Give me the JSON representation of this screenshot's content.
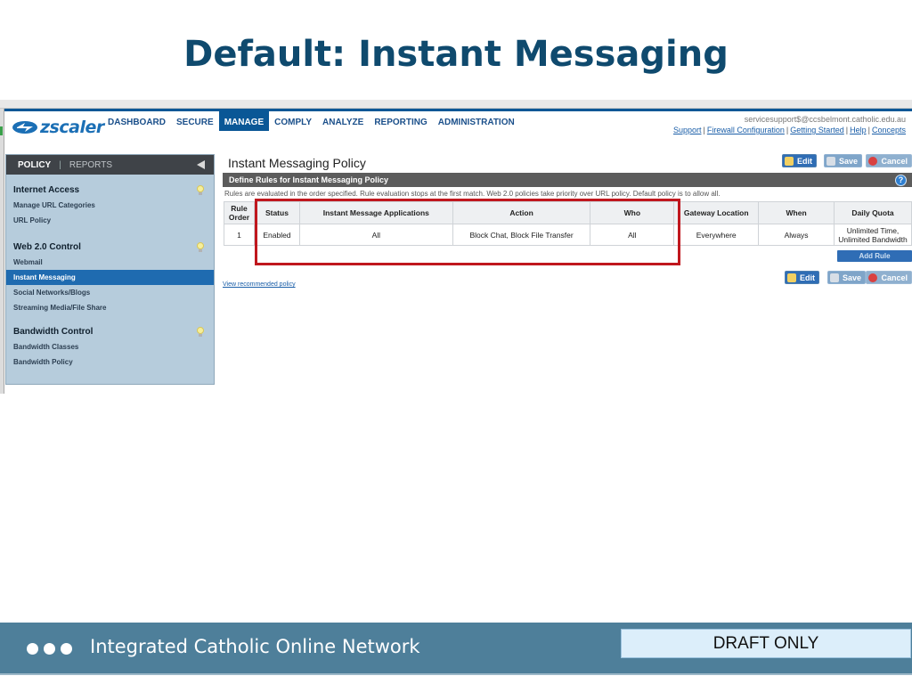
{
  "slide": {
    "title": "Default: Instant Messaging"
  },
  "app": {
    "logo_text": "zscaler",
    "nav": [
      "DASHBOARD",
      "SECURE",
      "MANAGE",
      "COMPLY",
      "ANALYZE",
      "REPORTING",
      "ADMINISTRATION"
    ],
    "active_nav": "MANAGE",
    "account_email": "servicesupport$@ccsbelmont.catholic.edu.au",
    "account_links": [
      "Support",
      "Firewall Configuration",
      "Getting Started",
      "Help",
      "Concepts"
    ]
  },
  "sidebar": {
    "tab_policy": "POLICY",
    "tab_separator": "|",
    "tab_reports": "REPORTS",
    "sections": [
      {
        "heading": "Internet Access",
        "items": [
          "Manage URL Categories",
          "URL Policy"
        ]
      },
      {
        "heading": "Web 2.0 Control",
        "items": [
          "Webmail",
          "Instant Messaging",
          "Social Networks/Blogs",
          "Streaming Media/File Share"
        ]
      },
      {
        "heading": "Bandwidth Control",
        "items": [
          "Bandwidth Classes",
          "Bandwidth Policy"
        ]
      }
    ],
    "selected_item": "Instant Messaging"
  },
  "main": {
    "page_title": "Instant Messaging Policy",
    "buttons": {
      "edit": "Edit",
      "save": "Save",
      "cancel": "Cancel"
    },
    "define_title": "Define Rules for Instant Messaging Policy",
    "help": "?",
    "rules_note": "Rules are evaluated in the order specified. Rule evaluation stops at the first match. Web 2.0 policies take priority over URL policy. Default policy is to allow all.",
    "table": {
      "headers": [
        "Rule Order",
        "Status",
        "Instant Message Applications",
        "Action",
        "Who",
        "Gateway Location",
        "When",
        "Daily Quota"
      ],
      "rows": [
        [
          "1",
          "Enabled",
          "All",
          "Block Chat, Block File Transfer",
          "All",
          "Everywhere",
          "Always",
          "Unlimited Time, Unlimited Bandwidth"
        ]
      ]
    },
    "add_rule": "Add Rule",
    "recommended_link": "View recommended policy"
  },
  "footer": {
    "network": "Integrated Catholic Online Network",
    "draft": "DRAFT ONLY"
  },
  "colors": {
    "title": "#0f4a6e",
    "footer": "#4e7f9a",
    "highlight": "#c0171e",
    "brand_blue": "#0a5796"
  }
}
